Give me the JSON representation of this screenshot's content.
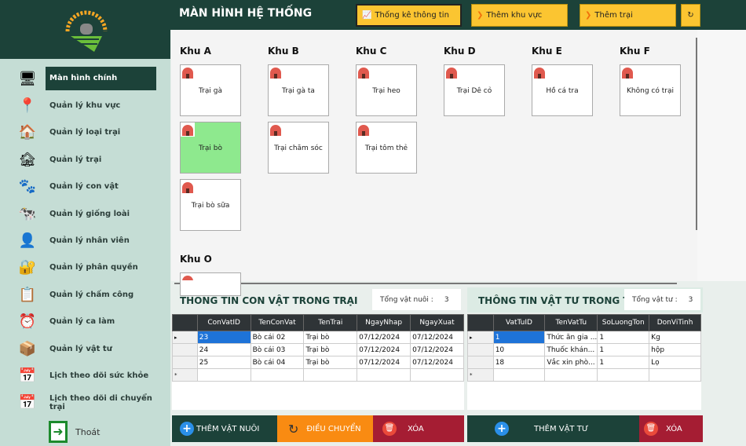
{
  "header": {
    "title": "MÀN HÌNH HỆ THỐNG",
    "buttons": [
      {
        "label": "Thống kê thông tin",
        "icon": "chart-icon"
      },
      {
        "label": "Thêm khu vực",
        "icon": "chevron-down-icon"
      },
      {
        "label": "Thêm trại",
        "icon": "chevron-down-icon"
      }
    ]
  },
  "sidebar": {
    "items": [
      {
        "label": "Màn hình chính",
        "icon": "monitor-icon",
        "glyph": "🖥"
      },
      {
        "label": "Quản lý khu vực",
        "icon": "location-pin-icon",
        "glyph": "📍"
      },
      {
        "label": "Quản lý loại trại",
        "icon": "barn-icon",
        "glyph": "🏠"
      },
      {
        "label": "Quản lý trại",
        "icon": "farmhouse-icon",
        "glyph": "🏚"
      },
      {
        "label": "Quản lý con vật",
        "icon": "paw-icon",
        "glyph": "🐾"
      },
      {
        "label": "Quản lý giống loài",
        "icon": "animals-icon",
        "glyph": "🐄"
      },
      {
        "label": "Quản lý nhân viên",
        "icon": "employee-icon",
        "glyph": "👤"
      },
      {
        "label": "Quản lý phân quyền",
        "icon": "permission-icon",
        "glyph": "🔐"
      },
      {
        "label": "Quản lý chấm công",
        "icon": "notes-icon",
        "glyph": "📋"
      },
      {
        "label": "Quản lý ca làm",
        "icon": "alarm-clock-icon",
        "glyph": "⏰"
      },
      {
        "label": "Quản lý vật tư",
        "icon": "warehouse-icon",
        "glyph": "📦"
      },
      {
        "label": "Lịch theo dõi sức khỏe",
        "icon": "calendar-icon",
        "glyph": "📅"
      },
      {
        "label": "Lịch theo dõi di chuyển trại",
        "icon": "calendar-icon",
        "glyph": "📅"
      }
    ],
    "logout": "Thoát"
  },
  "zones": [
    {
      "name": "Khu A",
      "farms": [
        "Trại gà",
        "Trại bò",
        "Trại bò sữa"
      ]
    },
    {
      "name": "Khu B",
      "farms": [
        "Trại gà ta",
        "Trại chăm sóc"
      ]
    },
    {
      "name": "Khu C",
      "farms": [
        "Trại heo",
        "Trại tôm thẻ"
      ]
    },
    {
      "name": "Khu D",
      "farms": [
        "Trại Dê cỏ"
      ]
    },
    {
      "name": "Khu E",
      "farms": [
        "Hồ cá tra"
      ]
    },
    {
      "name": "Khu F",
      "farms": [
        "Không có trại"
      ]
    },
    {
      "name": "Khu O",
      "farms": [
        ""
      ]
    }
  ],
  "selected_farm": "Trại bò",
  "animals": {
    "title": "THÔNG TIN CON VẬT TRONG TRẠI",
    "count_label": "Tổng vật nuôi :",
    "count": "3",
    "columns": [
      "ConVatID",
      "TenConVat",
      "TenTrai",
      "NgayNhap",
      "NgayXuat"
    ],
    "rows": [
      [
        "23",
        "Bò cái 02",
        "Trại bò",
        "07/12/2024",
        "07/12/2024"
      ],
      [
        "24",
        "Bò cái 03",
        "Trại bò",
        "07/12/2024",
        "07/12/2024"
      ],
      [
        "25",
        "Bò cái 04",
        "Trại bò",
        "07/12/2024",
        "07/12/2024"
      ]
    ],
    "buttons": {
      "add": "THÊM VẬT NUÔI",
      "transfer": "ĐIỀU CHUYỂN",
      "delete": "XÓA"
    }
  },
  "supplies": {
    "title": "THÔNG TIN VẬT TƯ TRONG TRẠI",
    "count_label": "Tổng vật tư :",
    "count": "3",
    "columns": [
      "VatTuID",
      "TenVatTu",
      "SoLuongTon",
      "DonViTinh"
    ],
    "rows": [
      [
        "1",
        "Thức ăn gia ...",
        "1",
        "Kg"
      ],
      [
        "10",
        "Thuốc khán...",
        "1",
        "hộp"
      ],
      [
        "18",
        "Vắc xin phò...",
        "1",
        "Lọ"
      ]
    ],
    "buttons": {
      "add": "THÊM VẬT TƯ",
      "delete": "XÓA"
    }
  },
  "colors": {
    "dark_green": "#1c4239",
    "sidebar": "#c5ddd5",
    "yellow": "#fbc531",
    "orange": "#f98b12",
    "red": "#a51d33",
    "selected": "#8ee98e"
  }
}
